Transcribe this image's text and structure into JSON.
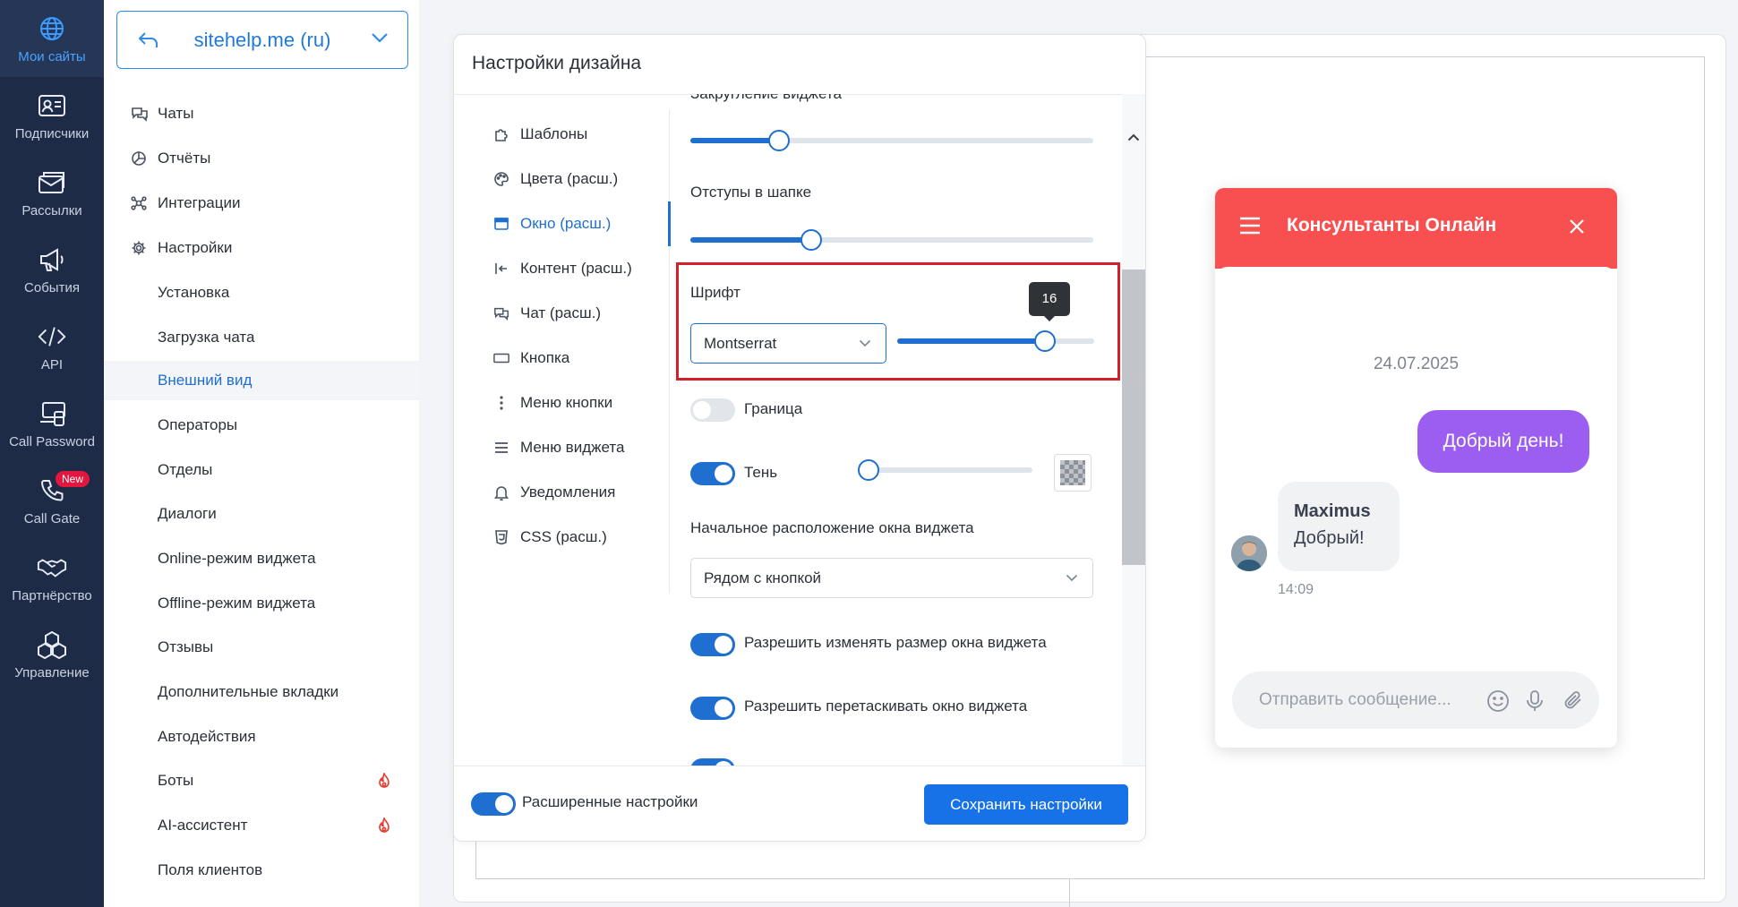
{
  "rail": {
    "items": [
      {
        "label": "Мои сайты",
        "icon": "globe-icon"
      },
      {
        "label": "Подписчики",
        "icon": "id-card-icon"
      },
      {
        "label": "Рассылки",
        "icon": "mail-icon"
      },
      {
        "label": "События",
        "icon": "megaphone-icon"
      },
      {
        "label": "API",
        "icon": "code-icon"
      },
      {
        "label": "Call Password",
        "icon": "devices-icon"
      },
      {
        "label": "Call Gate",
        "icon": "phone-icon",
        "badge": "New"
      },
      {
        "label": "Партнёрство",
        "icon": "handshake-icon"
      },
      {
        "label": "Управление",
        "icon": "boxes-icon"
      }
    ]
  },
  "sidebar": {
    "site": "sitehelp.me (ru)",
    "items": [
      {
        "label": "Чаты"
      },
      {
        "label": "Отчёты"
      },
      {
        "label": "Интеграции"
      },
      {
        "label": "Настройки"
      },
      {
        "label": "Установка"
      },
      {
        "label": "Загрузка чата"
      },
      {
        "label": "Внешний вид"
      },
      {
        "label": "Операторы"
      },
      {
        "label": "Отделы"
      },
      {
        "label": "Диалоги"
      },
      {
        "label": "Online-режим виджета"
      },
      {
        "label": "Offline-режим виджета"
      },
      {
        "label": "Отзывы"
      },
      {
        "label": "Дополнительные вкладки"
      },
      {
        "label": "Автодействия"
      },
      {
        "label": "Боты"
      },
      {
        "label": "AI-ассистент"
      },
      {
        "label": "Поля клиентов"
      }
    ]
  },
  "panel": {
    "title": "Настройки дизайна",
    "tabs": [
      {
        "label": "Шаблоны"
      },
      {
        "label": "Цвета (расш.)"
      },
      {
        "label": "Окно (расш.)"
      },
      {
        "label": "Контент (расш.)"
      },
      {
        "label": "Чат (расш.)"
      },
      {
        "label": "Кнопка"
      },
      {
        "label": "Меню кнопки"
      },
      {
        "label": "Меню виджета"
      },
      {
        "label": "Уведомления"
      },
      {
        "label": "CSS (расш.)"
      }
    ],
    "rounding_label": "Закругление виджета",
    "rounding_level": 0.22,
    "header_padding_label": "Отступы в шапке",
    "header_padding_level": 0.3,
    "font_label": "Шрифт",
    "font_value": "Montserrat",
    "font_size": "16",
    "font_size_level": 0.75,
    "border_label": "Граница",
    "shadow_label": "Тень",
    "shadow_level": 0.05,
    "position_label": "Начальное расположение окна виджета",
    "position_value": "Рядом с кнопкой",
    "resize_label": "Разрешить изменять размер окна виджета",
    "drag_label": "Разрешить перетаскивать окно виджета",
    "advanced_label": "Расширенные настройки",
    "save_label": "Сохранить настройки"
  },
  "widget": {
    "title": "Консультанты Онлайн",
    "date": "24.07.2025",
    "outgoing": "Добрый день!",
    "sender": "Maximus",
    "incoming": "Добрый!",
    "time": "14:09",
    "input_placeholder": "Отправить сообщение...",
    "header_color": "#f85050",
    "bubble_color": "#9c5ef0"
  },
  "colors": {
    "accent": "#1f6fd1",
    "rail_bg": "#1e2b46",
    "highlight_border": "#d21f2a"
  }
}
